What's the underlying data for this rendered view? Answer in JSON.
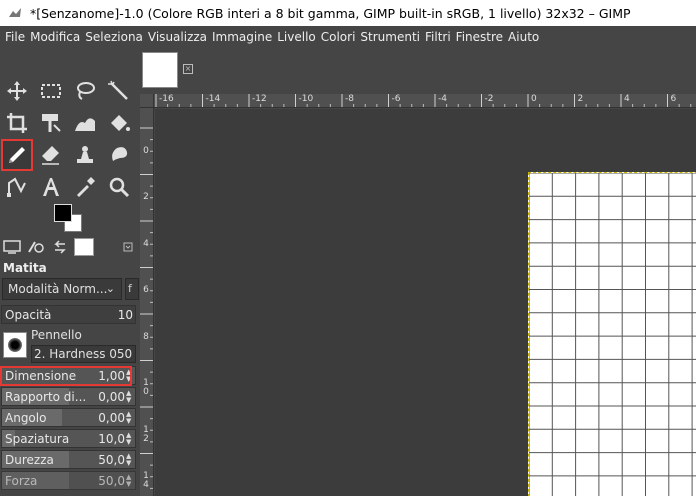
{
  "window": {
    "title": "*[Senzanome]-1.0 (Colore RGB interi a 8 bit gamma, GIMP built-in sRGB, 1 livello) 32x32 – GIMP"
  },
  "menu": [
    "File",
    "Modifica",
    "Seleziona",
    "Visualizza",
    "Immagine",
    "Livello",
    "Colori",
    "Strumenti",
    "Filtri",
    "Finestre",
    "Aiuto"
  ],
  "tool_options": {
    "title": "Matita",
    "mode": "Modalità Norm...",
    "mode_extra": "f",
    "brush_label": "Pennello",
    "brush_name": "2. Hardness 050",
    "sliders": {
      "opacity": {
        "label": "Opacità",
        "value": "10",
        "fill": 1.0
      },
      "size": {
        "label": "Dimensione",
        "value": "1,00",
        "fill": 0.0
      },
      "ratio": {
        "label": "Rapporto di...",
        "value": "0,00",
        "fill": 0.5
      },
      "angle": {
        "label": "Angolo",
        "value": "0,00",
        "fill": 0.45
      },
      "spacing": {
        "label": "Spaziatura",
        "value": "10,0",
        "fill": 0.1
      },
      "hardness": {
        "label": "Durezza",
        "value": "50,0",
        "fill": 0.5
      },
      "force": {
        "label": "Forza",
        "value": "50,0",
        "fill": 0.5
      }
    }
  },
  "ruler": {
    "h_labels": [
      "-16",
      "-14",
      "-12",
      "-10",
      "-8",
      "-6",
      "-4",
      "-2",
      "0",
      "2",
      "4",
      "6"
    ],
    "v_labels": [
      "2",
      "0",
      "2",
      "4",
      "6",
      "8",
      "10",
      "12",
      "14"
    ]
  },
  "colors": {
    "accent": "#e53935",
    "foreground": "#000000",
    "background": "#ffffff"
  },
  "icons": [
    "move-icon",
    "rect-select-icon",
    "lasso-icon",
    "fuzzy-select-icon",
    "crop-icon",
    "transform-icon",
    "warp-icon",
    "bucket-fill-icon",
    "pencil-icon",
    "eraser-icon",
    "clone-icon",
    "smudge-icon",
    "path-icon",
    "text-icon",
    "color-picker-icon",
    "zoom-icon"
  ]
}
